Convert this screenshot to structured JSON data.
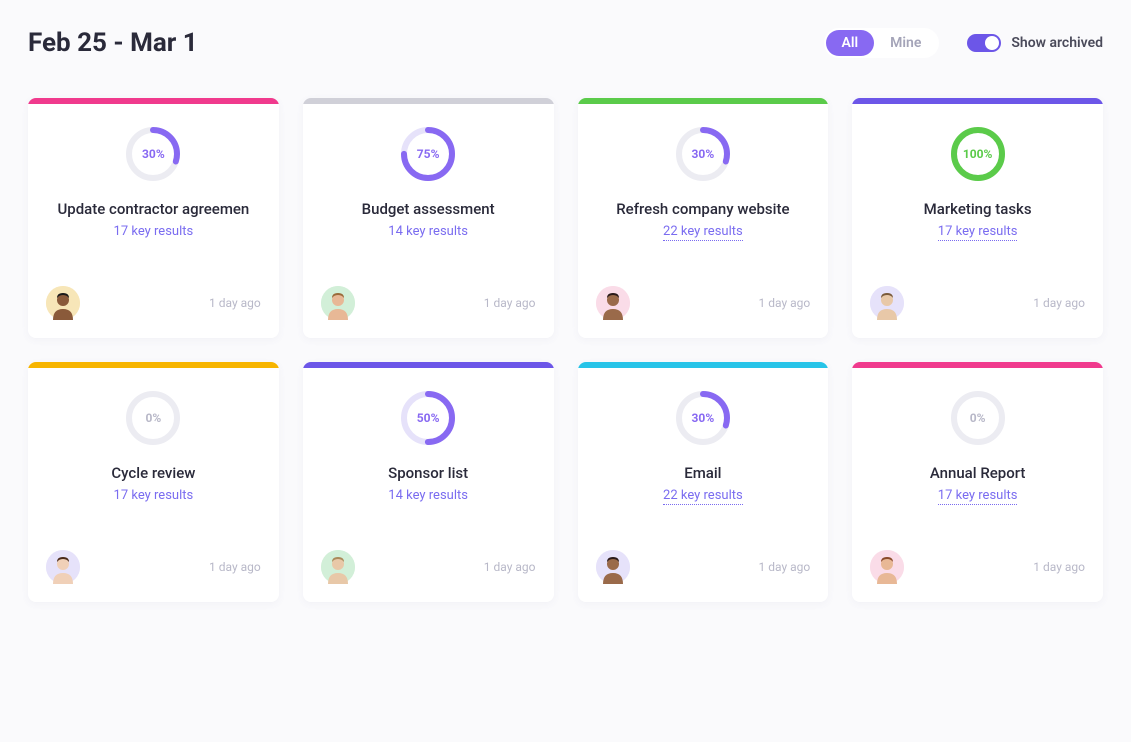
{
  "header": {
    "date_range": "Feb 25 - Mar 1",
    "filter_all": "All",
    "filter_mine": "Mine",
    "toggle_label": "Show archived"
  },
  "colors": {
    "purple": "#8869f2",
    "purple_light": "#e6e2fa",
    "green": "#5bcb4a",
    "grey_light": "#ececf2"
  },
  "cards": [
    {
      "accent": "#f03a8d",
      "percent": 30,
      "percent_label": "30%",
      "ring_color": "#8869f2",
      "ring_bg": "#ececf2",
      "pct_text_color": "#8869f2",
      "title": "Update contractor agreemen",
      "sub": "17 key results",
      "underline": false,
      "time": "1 day ago",
      "avatar_bg": "#f7e6b8",
      "avatar_skin": "#8a5a3a",
      "avatar_hair": "#1a1a1a"
    },
    {
      "accent": "#d0d0d8",
      "percent": 75,
      "percent_label": "75%",
      "ring_color": "#8869f2",
      "ring_bg": "#e6e2fa",
      "pct_text_color": "#8869f2",
      "title": "Budget assessment",
      "sub": "14 key results",
      "underline": false,
      "time": "1 day ago",
      "avatar_bg": "#d2efd8",
      "avatar_skin": "#e8b896",
      "avatar_hair": "#9a6a3a"
    },
    {
      "accent": "#5bcb4a",
      "percent": 30,
      "percent_label": "30%",
      "ring_color": "#8869f2",
      "ring_bg": "#ececf2",
      "pct_text_color": "#8869f2",
      "title": "Refresh company website",
      "sub": "22 key results",
      "underline": true,
      "time": "1 day ago",
      "avatar_bg": "#fadce8",
      "avatar_skin": "#9a6a4a",
      "avatar_hair": "#2a1a1a"
    },
    {
      "accent": "#6c56e8",
      "percent": 100,
      "percent_label": "100%",
      "ring_color": "#5bcb4a",
      "ring_bg": "#d8f2d4",
      "pct_text_color": "#5bcb4a",
      "title": "Marketing tasks",
      "sub": "17 key results",
      "underline": true,
      "time": "1 day ago",
      "avatar_bg": "#e6e2fa",
      "avatar_skin": "#e8c8a8",
      "avatar_hair": "#7a5a3a"
    },
    {
      "accent": "#f7b500",
      "percent": 0,
      "percent_label": "0%",
      "ring_color": "#8869f2",
      "ring_bg": "#ececf2",
      "pct_text_color": "#b8b8c8",
      "title": "Cycle review",
      "sub": "17 key results",
      "underline": false,
      "time": "1 day ago",
      "avatar_bg": "#e6e2fa",
      "avatar_skin": "#f0d0b8",
      "avatar_hair": "#4a2a1a"
    },
    {
      "accent": "#6c56e8",
      "percent": 50,
      "percent_label": "50%",
      "ring_color": "#8869f2",
      "ring_bg": "#e6e2fa",
      "pct_text_color": "#8869f2",
      "title": "Sponsor list",
      "sub": "14 key results",
      "underline": false,
      "time": "1 day ago",
      "avatar_bg": "#d2efd8",
      "avatar_skin": "#e8c8a8",
      "avatar_hair": "#aa8a5a"
    },
    {
      "accent": "#27c4e8",
      "percent": 30,
      "percent_label": "30%",
      "ring_color": "#8869f2",
      "ring_bg": "#ececf2",
      "pct_text_color": "#8869f2",
      "title": "Email",
      "sub": "22 key results",
      "underline": true,
      "time": "1 day ago",
      "avatar_bg": "#e6e2fa",
      "avatar_skin": "#9a6a4a",
      "avatar_hair": "#2a1a1a"
    },
    {
      "accent": "#f03a8d",
      "percent": 0,
      "percent_label": "0%",
      "ring_color": "#8869f2",
      "ring_bg": "#ececf2",
      "pct_text_color": "#b8b8c8",
      "title": "Annual Report",
      "sub": "17 key results",
      "underline": true,
      "time": "1 day ago",
      "avatar_bg": "#fadce8",
      "avatar_skin": "#e8b896",
      "avatar_hair": "#8a4a2a"
    }
  ]
}
